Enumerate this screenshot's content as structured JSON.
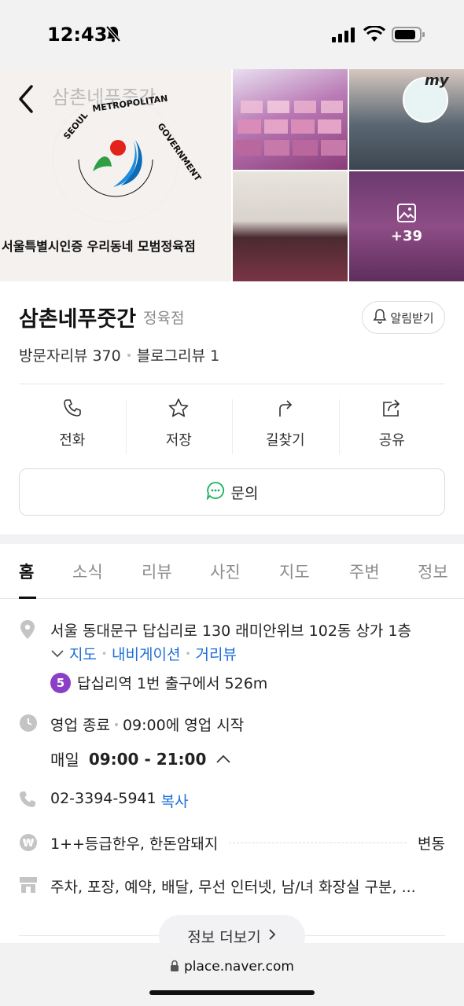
{
  "status_bar": {
    "time": "12:43"
  },
  "photos": {
    "main_caption_top": "삼촌네푸줏간",
    "main_caption_bottom": "서울특별시인증 우리동네 모범정육점",
    "more_count": "+39",
    "avatar_label": "my"
  },
  "place": {
    "name": "삼촌네푸줏간",
    "category": "정육점",
    "alert_label": "알림받기",
    "visitor_reviews": "방문자리뷰 370",
    "blog_reviews": "블로그리뷰 1"
  },
  "actions": {
    "call": "전화",
    "save": "저장",
    "directions": "길찾기",
    "share": "공유"
  },
  "inquiry_label": "문의",
  "tabs": [
    "홈",
    "소식",
    "리뷰",
    "사진",
    "지도",
    "주변",
    "정보"
  ],
  "info": {
    "address": "서울 동대문구 답십리로 130 래미안위브 102동 상가 1층",
    "links": [
      "지도",
      "내비게이션",
      "거리뷰"
    ],
    "subway_line": "5",
    "subway_text": "답십리역 1번 출구에서 526m",
    "hours_status": "영업 종료",
    "hours_next": "09:00에 영업 시작",
    "hours_day": "매일",
    "hours_range": "09:00 - 21:00",
    "phone": "02-3394-5941",
    "copy_label": "복사",
    "menu": "1++등급한우, 한돈암돼지",
    "menu_price": "변동",
    "amenities": "주차, 포장, 예약, 배달, 무선 인터넷, 남/녀 화장실 구분, ...",
    "more_label": "정보 더보기"
  },
  "url": "place.naver.com",
  "colors": {
    "link": "#1e6fd9",
    "subway_line5": "#8b3fc7"
  }
}
